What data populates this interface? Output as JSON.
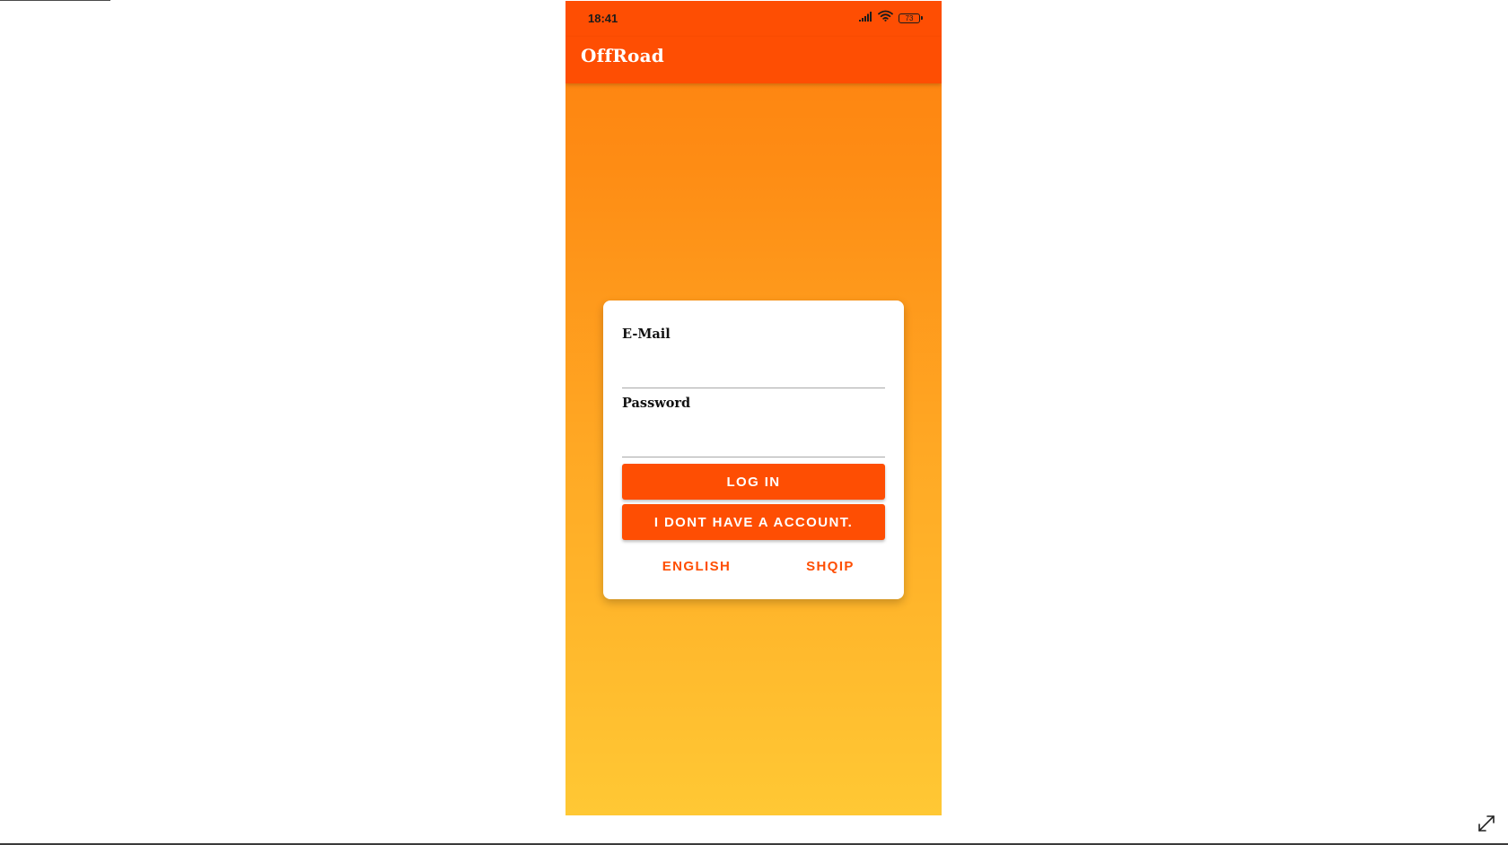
{
  "status_bar": {
    "time": "18:41",
    "battery_level": "73",
    "icons": [
      "signal-icon",
      "wifi-icon",
      "battery-icon"
    ]
  },
  "app_bar": {
    "title": "OffRoad"
  },
  "login_form": {
    "email_label": "E-Mail",
    "email_value": "",
    "password_label": "Password",
    "password_value": "",
    "login_label": "LOG IN",
    "signup_label": "I DONT HAVE A ACCOUNT.",
    "language_options": [
      "ENGLISH",
      "SHQIP"
    ]
  },
  "colors": {
    "primary": "#fe4e03",
    "gradient_top": "#fe800f",
    "gradient_bottom": "#ffc834",
    "card_background": "#ffffff"
  },
  "viewer": {
    "icons": [
      "expand-icon"
    ]
  }
}
